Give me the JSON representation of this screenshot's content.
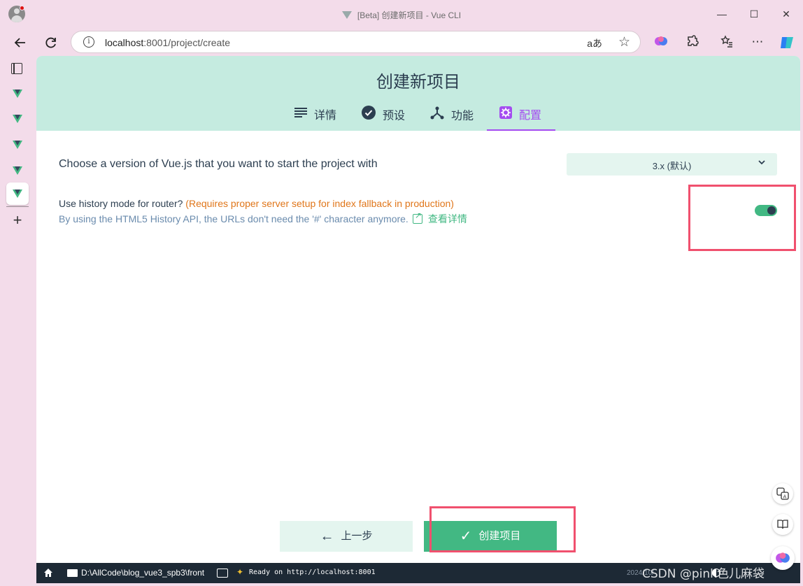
{
  "window": {
    "title": "[Beta] 创建新项目 - Vue CLI",
    "min": "—",
    "max": "☐",
    "close": "✕"
  },
  "browser": {
    "url_host": "localhost",
    "url_path": ":8001/project/create",
    "read_aloud": "aあ"
  },
  "page": {
    "title": "创建新项目",
    "tabs": [
      {
        "label": "详情",
        "icon": "list-icon"
      },
      {
        "label": "预设",
        "icon": "check-circle-icon"
      },
      {
        "label": "功能",
        "icon": "fork-icon"
      },
      {
        "label": "配置",
        "icon": "gear-icon"
      }
    ],
    "active_tab": "配置"
  },
  "config": {
    "vue_version_label": "Choose a version of Vue.js that you want to start the project with",
    "vue_version_value": "3.x (默认)",
    "history_question": "Use history mode for router? ",
    "history_warning": "(Requires proper server setup for index fallback in production)",
    "history_desc": "By using the HTML5 History API, the URLs don't need the '#' character anymore.",
    "history_link": "查看详情",
    "history_enabled": true
  },
  "buttons": {
    "prev": "上一步",
    "create": "创建项目"
  },
  "statusbar": {
    "path": "D:\\AllCode\\blog_vue3_spb3\\front",
    "ready": "Ready on http://localhost:8001",
    "date": "2024/10/"
  },
  "watermark": "CSDN @pink色儿麻袋",
  "colors": {
    "accent": "#42b883",
    "active_tab": "#a44cf0",
    "header_bg": "#c5ebe0",
    "warning": "#e0761a",
    "highlight": "#f0506e"
  }
}
